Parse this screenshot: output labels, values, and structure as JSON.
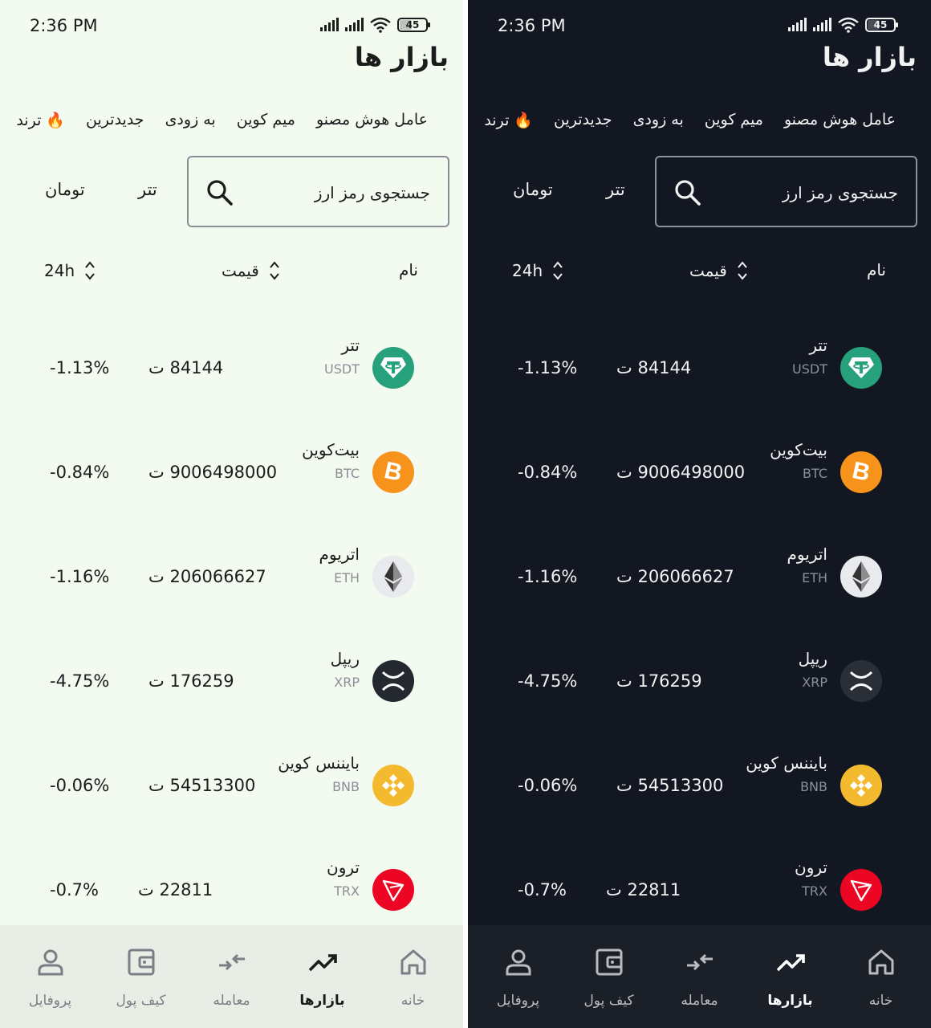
{
  "status": {
    "time": "2:36 PM",
    "battery": "45"
  },
  "header": {
    "title": "بازار ها"
  },
  "categories": [
    {
      "label": "ترند",
      "emoji": "🔥"
    },
    {
      "label": "جدیدترین"
    },
    {
      "label": "به زودی"
    },
    {
      "label": "میم کوین"
    },
    {
      "label": "عامل هوش مصنو"
    }
  ],
  "search": {
    "placeholder": "جستجوی رمز ارز"
  },
  "quote_tabs": {
    "tether": "تتر",
    "toman": "تومان"
  },
  "columns": {
    "name": "نام",
    "price": "قیمت",
    "change": "24h"
  },
  "coins": [
    {
      "name": "تتر",
      "symbol": "USDT",
      "price": "84144 ت",
      "change": "-1.13%",
      "logo_color": "#26a17b"
    },
    {
      "name": "بیت‌کوین",
      "symbol": "BTC",
      "price": "9006498000 ت",
      "change": "-0.84%",
      "logo_color": "#f7931a"
    },
    {
      "name": "اتریوم",
      "symbol": "ETH",
      "price": "206066627 ت",
      "change": "-1.16%",
      "logo_color": "#e9eaee"
    },
    {
      "name": "ریپل",
      "symbol": "XRP",
      "price": "176259 ت",
      "change": "-4.75%",
      "logo_color": "#23292f"
    },
    {
      "name": "بایننس کوین",
      "symbol": "BNB",
      "price": "54513300 ت",
      "change": "-0.06%",
      "logo_color": "#f3ba2f"
    },
    {
      "name": "ترون",
      "symbol": "TRX",
      "price": "22811 ت",
      "change": "-0.7%",
      "logo_color": "#ec0623"
    }
  ],
  "nav": [
    {
      "label": "خانه",
      "icon": "home-icon"
    },
    {
      "label": "بازارها",
      "icon": "trending-up-icon",
      "active": true
    },
    {
      "label": "معامله",
      "icon": "swap-arrows-icon"
    },
    {
      "label": "کیف پول",
      "icon": "wallet-icon"
    },
    {
      "label": "پروفایل",
      "icon": "user-icon"
    }
  ],
  "themes": {
    "light_bg": "#f3faf0",
    "dark_bg": "#121722"
  }
}
